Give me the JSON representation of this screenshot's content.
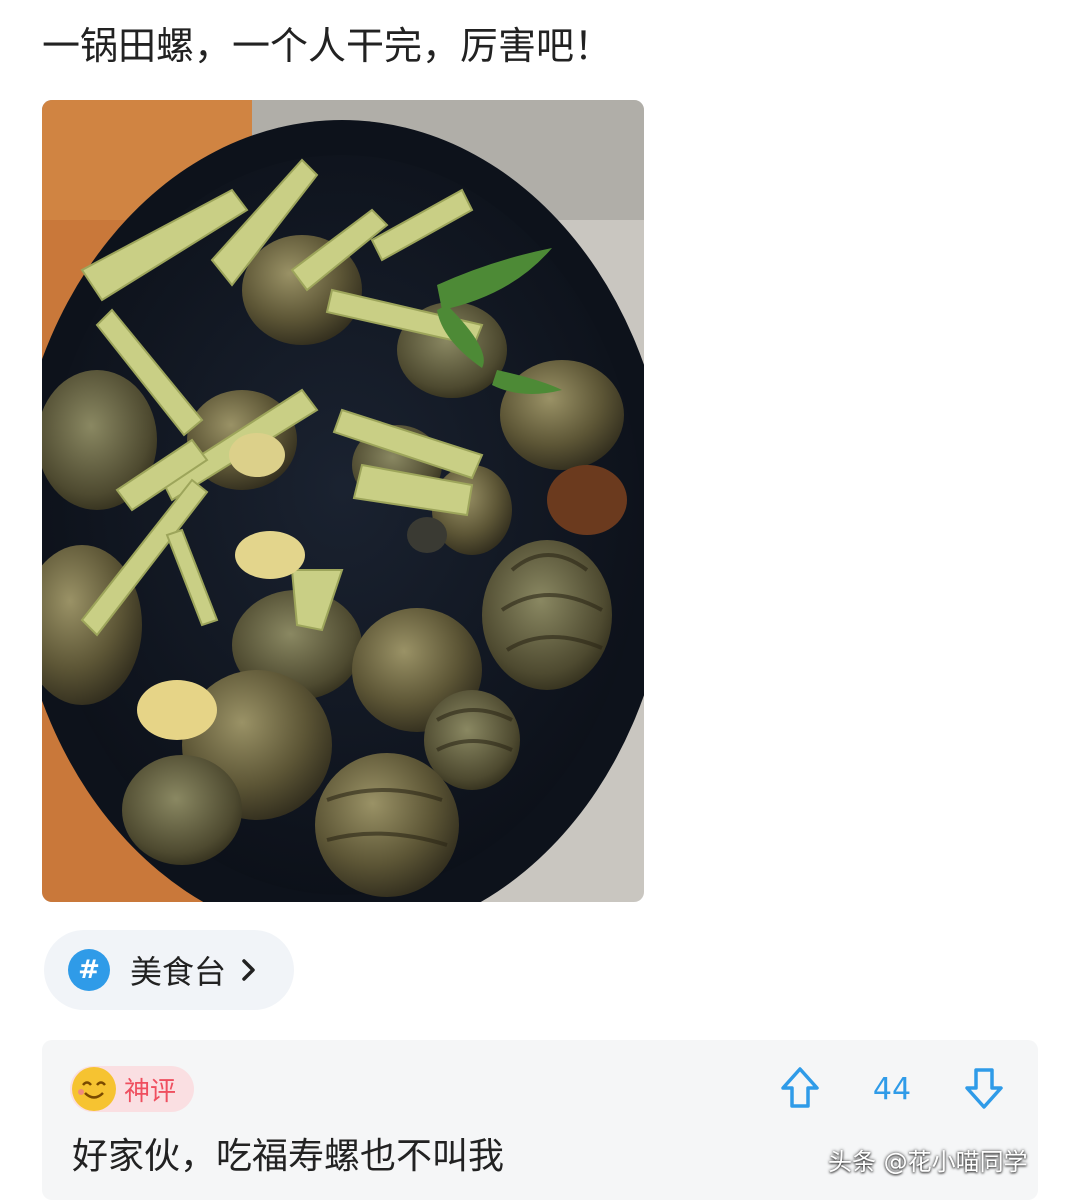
{
  "post": {
    "title": "一锅田螺，一个人干完，厉害吧！"
  },
  "topic": {
    "icon": "hash-icon",
    "label": "美食台"
  },
  "comment": {
    "badge_label": "神评",
    "vote_count": "44",
    "text": "好家伙，吃福寿螺也不叫我"
  },
  "watermark": {
    "text": "头条 @花小喵同学"
  },
  "colors": {
    "accent": "#2f9be8",
    "badge_text": "#ef4f5f",
    "badge_bg": "#fadfe2",
    "card_bg": "#f5f6f7"
  }
}
